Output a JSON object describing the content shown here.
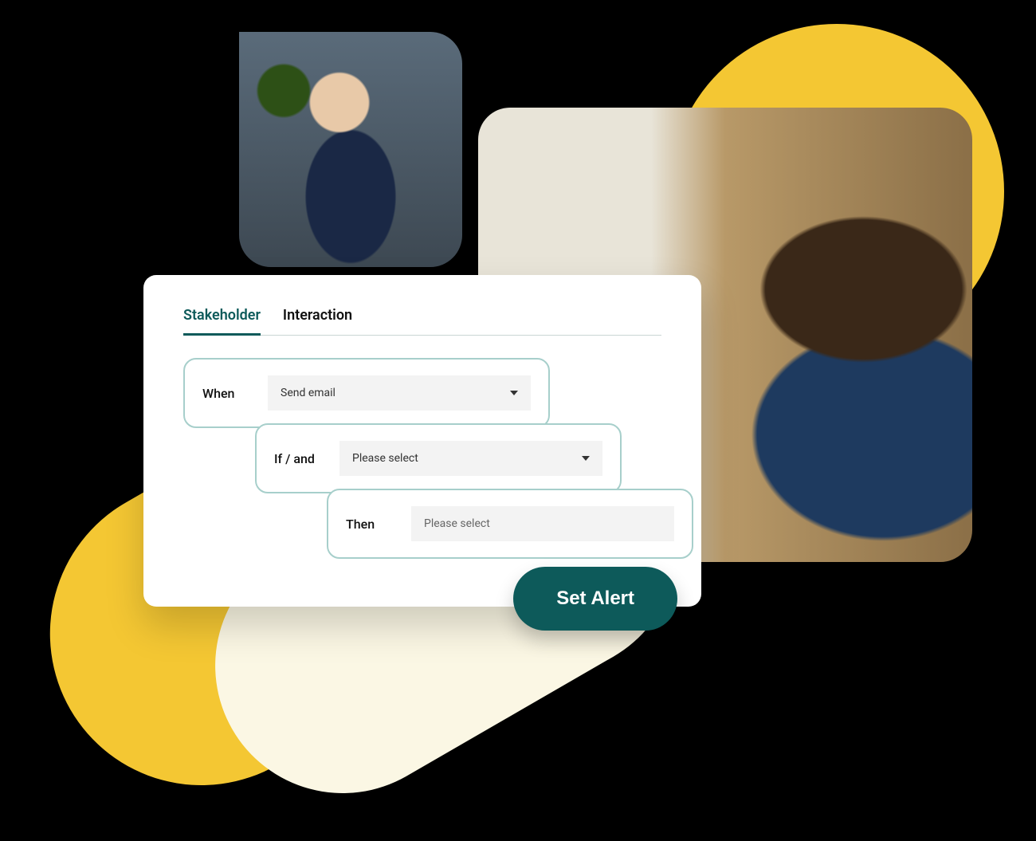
{
  "tabs": {
    "active": "Stakeholder",
    "inactive": "Interaction"
  },
  "rules": {
    "when": {
      "label": "When",
      "value": "Send email"
    },
    "if": {
      "label": "If / and",
      "value": "Please select"
    },
    "then": {
      "label": "Then",
      "value": "Please select"
    }
  },
  "cta": "Set Alert",
  "colors": {
    "accent": "#0d5a5a",
    "yellow": "#f4c733",
    "border": "#a7cfcb"
  }
}
